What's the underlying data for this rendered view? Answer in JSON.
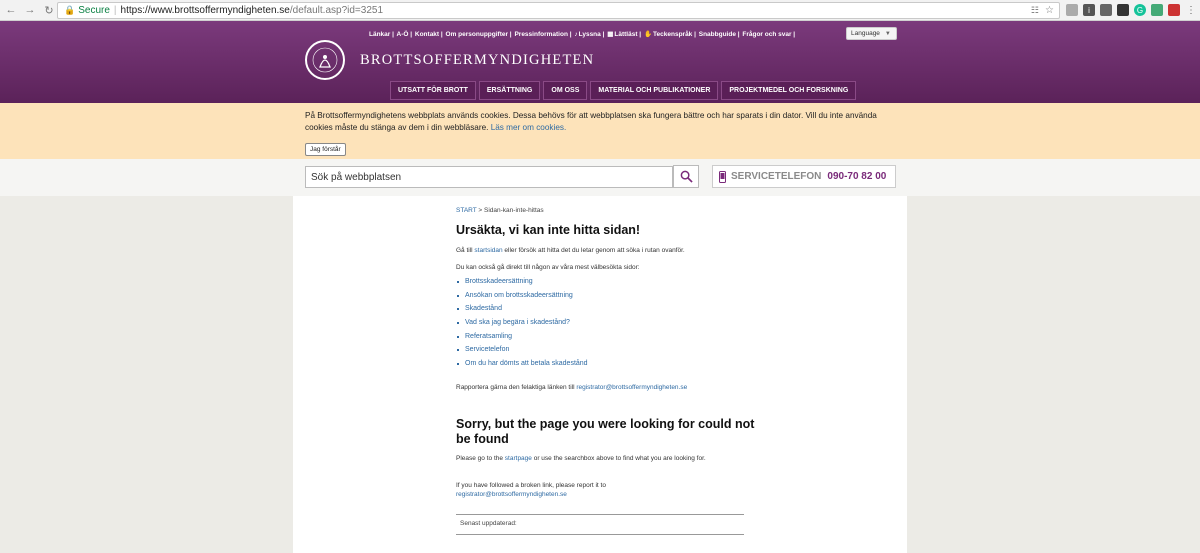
{
  "browser": {
    "secure_label": "Secure",
    "url_host": "https://www.brottsoffermyndigheten.se",
    "url_path": "/default.asp?id=3251"
  },
  "header": {
    "toplinks": [
      "Länkar |",
      "A-Ö |",
      "Kontakt |",
      "Om personuppgifter |",
      "Pressinformation |",
      "Lyssna |",
      "Lättläst |",
      "Teckenspråk |",
      "Snabbguide |",
      "Frågor och svar |"
    ],
    "language_label": "Language",
    "logo_text": "BROTTSOFFERMYNDIGHETEN",
    "nav": [
      "UTSATT FÖR BROTT",
      "ERSÄTTNING",
      "OM OSS",
      "MATERIAL OCH PUBLIKATIONER",
      "PROJEKTMEDEL OCH FORSKNING"
    ]
  },
  "cookie": {
    "text": "På Brottsoffermyndighetens webbplats används cookies. Dessa behövs för att webbplatsen ska fungera bättre och har sparats i din dator. Vill du inte använda cookies måste du stänga av dem i din webbläsare.",
    "link": "Läs mer om cookies.",
    "button": "Jag förstår"
  },
  "search": {
    "placeholder": "Sök på webbplatsen"
  },
  "service": {
    "label": "SERVICETELEFON",
    "number": "090-70 82 00"
  },
  "content": {
    "breadcrumb_start": "START",
    "breadcrumb_sep": ">",
    "breadcrumb_current": "Sidan-kan-inte-hittas",
    "title_sv": "Ursäkta, vi kan inte hitta sidan!",
    "p1_pre": "Gå till ",
    "p1_link": "startsidan",
    "p1_post": " eller försök att hitta det du letar genom att söka i rutan ovanför.",
    "p2": "Du kan också gå direkt till någon av våra mest välbesökta sidor:",
    "links": [
      "Brottsskadeersättning",
      "Ansökan om brottsskadeersättning",
      "Skadestånd",
      "Vad ska jag begära i skadestånd?",
      "Referatsamling",
      "Servicetelefon",
      "Om du har dömts att betala skadestånd"
    ],
    "report_pre": "Rapportera gärna den felaktiga länken till ",
    "report_email": "registrator@brottsoffermyndigheten.se",
    "title_en": "Sorry, but the page you were looking for could not be found",
    "en_p1_pre": "Please go to the ",
    "en_p1_link": "startpage",
    "en_p1_post": " or use the searchbox above to find what you are looking for.",
    "en_p2": "If you have followed a broken link, please report it to",
    "en_email": "registrator@brottsoffermyndigheten.se",
    "updated": "Senast uppdaterad:"
  }
}
